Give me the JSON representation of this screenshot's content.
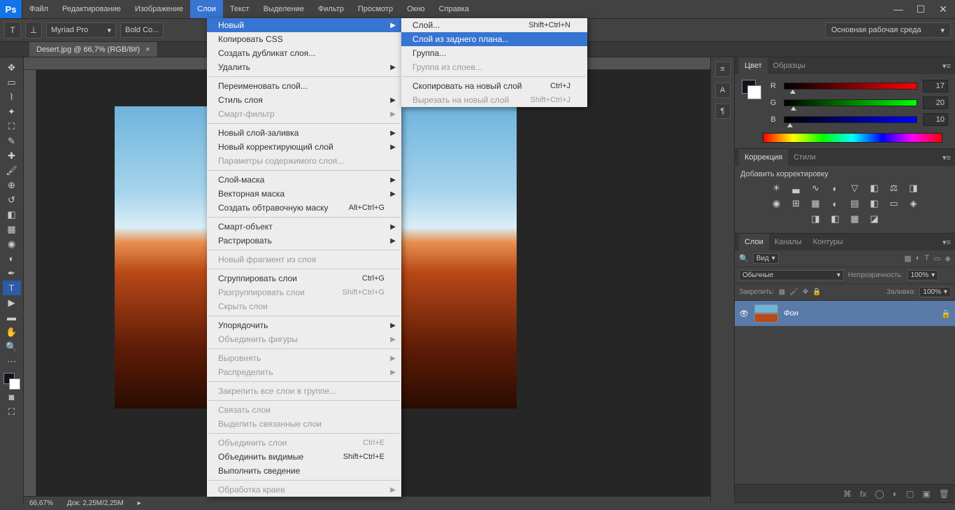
{
  "app": "Ps",
  "menubar": [
    "Файл",
    "Редактирование",
    "Изображение",
    "Слои",
    "Текст",
    "Выделение",
    "Фильтр",
    "Просмотр",
    "Окно",
    "Справка"
  ],
  "active_menu_index": 3,
  "options": {
    "font": "Myriad Pro",
    "weight": "Bold Co...",
    "workspace": "Основная рабочая среда"
  },
  "doc_tab": "Desert.jpg @ 66,7% (RGB/8#)",
  "dropdown": [
    {
      "label": "Новый",
      "arrow": true,
      "hl": true
    },
    {
      "label": "Копировать CSS"
    },
    {
      "label": "Создать дубликат слоя..."
    },
    {
      "label": "Удалить",
      "arrow": true
    },
    {
      "sep": true
    },
    {
      "label": "Переименовать слой..."
    },
    {
      "label": "Стиль слоя",
      "arrow": true
    },
    {
      "label": "Смарт-фильтр",
      "arrow": true,
      "dis": true
    },
    {
      "sep": true
    },
    {
      "label": "Новый слой-заливка",
      "arrow": true
    },
    {
      "label": "Новый корректирующий слой",
      "arrow": true
    },
    {
      "label": "Параметры содержимого слоя...",
      "dis": true
    },
    {
      "sep": true
    },
    {
      "label": "Слой-маска",
      "arrow": true
    },
    {
      "label": "Векторная маска",
      "arrow": true
    },
    {
      "label": "Создать обтравочную маску",
      "shortcut": "Alt+Ctrl+G"
    },
    {
      "sep": true
    },
    {
      "label": "Смарт-объект",
      "arrow": true
    },
    {
      "label": "Растрировать",
      "arrow": true
    },
    {
      "sep": true
    },
    {
      "label": "Новый фрагмент из слоя",
      "dis": true
    },
    {
      "sep": true
    },
    {
      "label": "Сгруппировать слои",
      "shortcut": "Ctrl+G"
    },
    {
      "label": "Разгруппировать слои",
      "shortcut": "Shift+Ctrl+G",
      "dis": true
    },
    {
      "label": "Скрыть слои",
      "dis": true
    },
    {
      "sep": true
    },
    {
      "label": "Упорядочить",
      "arrow": true
    },
    {
      "label": "Объединить фигуры",
      "arrow": true,
      "dis": true
    },
    {
      "sep": true
    },
    {
      "label": "Выровнять",
      "arrow": true,
      "dis": true
    },
    {
      "label": "Распределить",
      "arrow": true,
      "dis": true
    },
    {
      "sep": true
    },
    {
      "label": "Закрепить все слои в группе...",
      "dis": true
    },
    {
      "sep": true
    },
    {
      "label": "Связать слои",
      "dis": true
    },
    {
      "label": "Выделить связанные слои",
      "dis": true
    },
    {
      "sep": true
    },
    {
      "label": "Объединить слои",
      "shortcut": "Ctrl+E",
      "dis": true
    },
    {
      "label": "Объединить видимые",
      "shortcut": "Shift+Ctrl+E"
    },
    {
      "label": "Выполнить сведение"
    },
    {
      "sep": true
    },
    {
      "label": "Обработка краев",
      "arrow": true,
      "dis": true
    }
  ],
  "submenu": [
    {
      "label": "Слой...",
      "shortcut": "Shift+Ctrl+N"
    },
    {
      "label": "Слой из заднего плана...",
      "hl": true
    },
    {
      "label": "Группа..."
    },
    {
      "label": "Группа из слоев...",
      "dis": true
    },
    {
      "sep": true
    },
    {
      "label": "Скопировать на новый слой",
      "shortcut": "Ctrl+J"
    },
    {
      "label": "Вырезать на новый слой",
      "shortcut": "Shift+Ctrl+J",
      "dis": true
    }
  ],
  "color": {
    "tabs": [
      "Цвет",
      "Образцы"
    ],
    "r": 17,
    "g": 20,
    "b": 10
  },
  "adjust": {
    "tabs": [
      "Коррекция",
      "Стили"
    ],
    "title": "Добавить корректировку"
  },
  "layers": {
    "tabs": [
      "Слои",
      "Каналы",
      "Контуры"
    ],
    "filter": "Вид",
    "blend": "Обычные",
    "opacity_label": "Непрозрачность:",
    "opacity": "100%",
    "lock_label": "Закрепить:",
    "fill_label": "Заливка:",
    "fill": "100%",
    "item": "Фон"
  },
  "status": {
    "zoom": "66,67%",
    "doc": "Док: 2,25M/2,25M"
  }
}
